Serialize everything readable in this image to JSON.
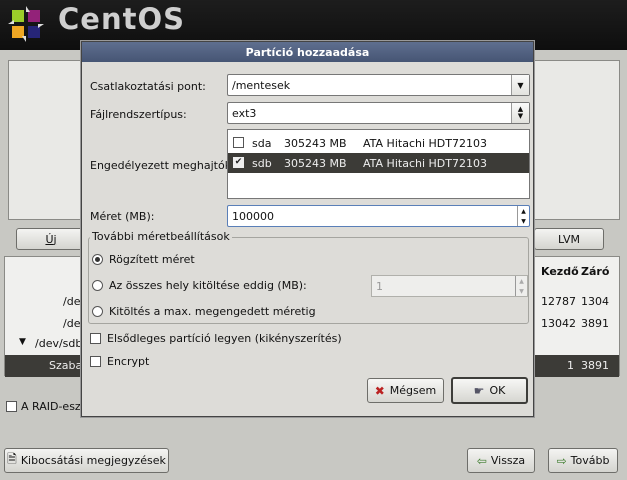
{
  "brand": {
    "name": "CentOS"
  },
  "background": {
    "buttons": {
      "new": "Új",
      "lvm": "LVM"
    },
    "table": {
      "headers": [
        "Kezdő",
        "Záró"
      ],
      "rows": [
        {
          "device": "/dev",
          "start": "12787",
          "end": "1304"
        },
        {
          "device": "/dev",
          "start": "13042",
          "end": "3891"
        },
        {
          "device": "/dev/sdb",
          "start": "",
          "end": ""
        },
        {
          "device": "Szaba",
          "start": "1",
          "end": "3891"
        }
      ]
    },
    "raid_label": "A RAID-eszk",
    "notes_button": "Kibocsátási megjegyzések",
    "back_button": "Vissza",
    "next_button": "Tovább"
  },
  "dialog": {
    "title": "Partíció hozzaadása",
    "mount_point": {
      "label": "Csatlakoztatási pont:",
      "value": "/mentesek"
    },
    "fs_type": {
      "label": "Fájlrendszertípus:",
      "value": "ext3"
    },
    "drives": {
      "label": "Engedélyezett meghajtók:",
      "items": [
        {
          "name": "sda",
          "size": "305243 MB",
          "model": "ATA Hitachi HDT72103",
          "checked": false
        },
        {
          "name": "sdb",
          "size": "305243 MB",
          "model": "ATA Hitachi HDT72103",
          "checked": true
        }
      ]
    },
    "size": {
      "label": "Méret (MB):",
      "value": "100000"
    },
    "options": {
      "legend": "További méretbeállítások",
      "fixed": "Rögzített méret",
      "fill_until": "Az összes hely kitöltése eddig (MB):",
      "fill_value": "1",
      "fill_max": "Kitöltés a max. megengedett méretig",
      "selected": "fixed"
    },
    "primary": {
      "label": "Elsődleges partíció legyen (kikényszerítés)",
      "checked": false
    },
    "encrypt": {
      "label": "Encrypt",
      "checked": false
    },
    "cancel_label": "Mégsem",
    "ok_label": "OK"
  }
}
